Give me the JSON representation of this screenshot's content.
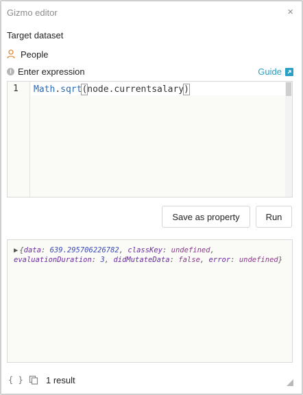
{
  "window": {
    "title": "Gizmo editor",
    "close_glyph": "×"
  },
  "target": {
    "section_label": "Target dataset",
    "dataset_name": "People",
    "icon": "person-icon"
  },
  "expression": {
    "label": "Enter expression",
    "guide_label": "Guide",
    "line_number": "1",
    "code": {
      "object": "Math",
      "dot": ".",
      "fn": "sqrt",
      "open_paren": "(",
      "arg": "node.currentsalary",
      "close_paren": ")"
    }
  },
  "buttons": {
    "save_as_property": "Save as property",
    "run": "Run"
  },
  "result": {
    "expander": "▶",
    "open": "{",
    "data_key": "data",
    "data_value": "639.295706226782",
    "classKey_key": "classKey",
    "classKey_value": "undefined",
    "evaluationDuration_key": "evaluationDuration",
    "evaluationDuration_value": "3",
    "didMutateData_key": "didMutateData",
    "didMutateData_value": "false",
    "error_key": "error",
    "error_value": "undefined",
    "close": "}"
  },
  "footer": {
    "braces": "{ }",
    "result_count": "1 result"
  },
  "colors": {
    "accent": "#2aa0c4",
    "person_icon": "#e08a3a",
    "code_keyword": "#2b69b3"
  }
}
